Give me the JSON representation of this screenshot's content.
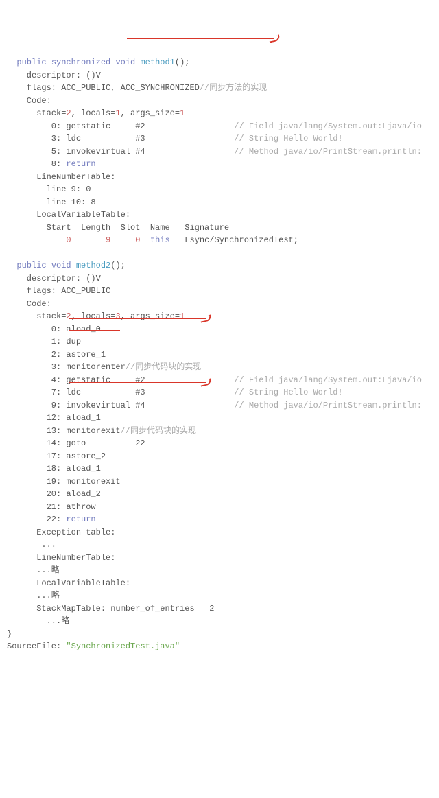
{
  "m1": {
    "sig_pre": "  ",
    "kw_public": "public",
    "kw_sync": "synchronized",
    "kw_void": "void",
    "name": "method1",
    "sig_post": "();",
    "desc_line": "    descriptor: ()V",
    "flags_pre": "    flags: ACC_PUBLIC, ",
    "flags_acc": "ACC_SYNCHRONIZED",
    "flags_cmt": "//同步方法的实现",
    "code_lbl": "    Code:",
    "stack_pre": "      stack=",
    "stack": "2",
    "locals_pre": ", locals=",
    "locals": "1",
    "args_pre": ", args_size=",
    "args": "1",
    "l0": "         0: getstatic     #2",
    "l0c": "                  // Field java/lang/System.out:Ljava/io",
    "l3": "         3: ldc           #3",
    "l3c": "                  // String Hello World!",
    "l5": "         5: invokevirtual #4",
    "l5c": "                  // Method java/io/PrintStream.println:",
    "l8": "         8: ",
    "l8_return": "return",
    "lnt": "      LineNumberTable:",
    "lnt1": "        line 9: 0",
    "lnt2": "        line 10: 8",
    "lvt": "      LocalVariableTable:",
    "lvth": "        Start  Length  Slot  Name   Signature",
    "lvtr_pre": "            ",
    "lvtr_0a": "0",
    "lvtr_mid1": "       ",
    "lvtr_9": "9",
    "lvtr_mid2": "     ",
    "lvtr_0b": "0",
    "lvtr_this": "  this",
    "lvtr_sig": "   Lsync/SynchronizedTest;"
  },
  "m2": {
    "sig_pre": "  ",
    "kw_public": "public",
    "kw_void": "void",
    "name": "method2",
    "sig_post": "();",
    "desc_line": "    descriptor: ()V",
    "flags": "    flags: ACC_PUBLIC",
    "code_lbl": "    Code:",
    "stack_pre": "      stack=",
    "stack": "2",
    "locals_pre": ", locals=",
    "locals": "3",
    "args_pre": ", args_size=",
    "args": "1",
    "l0": "         0: aload_0",
    "l1": "         1: dup",
    "l2": "         2: astore_1",
    "l3p": "         3: ",
    "l3_monitor": "monitorenter",
    "l3c": "//同步代码块的实现",
    "l4": "         4: getstatic     #2",
    "l4c": "                  // Field java/lang/System.out:Ljava/io",
    "l7": "         7: ldc           #3",
    "l7c": "                  // String Hello World!",
    "l9": "         9: invokevirtual #4",
    "l9c": "                  // Method java/io/PrintStream.println:",
    "l12": "        12: aload_1",
    "l13p": "        13: ",
    "l13_monitor": "monitorexit",
    "l13c": "//同步代码块的实现",
    "l14": "        14: goto          22",
    "l17": "        17: astore_2",
    "l18": "        18: aload_1",
    "l19": "        19: monitorexit",
    "l20": "        20: aload_2",
    "l21": "        21: athrow",
    "l22p": "        22: ",
    "l22_return": "return",
    "exc": "      Exception table:",
    "exc_dots": "       ...",
    "lnt": "      LineNumberTable:",
    "lnt_dots": "      ...略",
    "lvt": "      LocalVariableTable:",
    "lvt_dots": "      ...略",
    "smt": "      StackMapTable: number_of_entries = 2",
    "smt_dots": "        ...略"
  },
  "brace": "}",
  "src_pre": "SourceFile: ",
  "src_file": "\"SynchronizedTest.java\""
}
